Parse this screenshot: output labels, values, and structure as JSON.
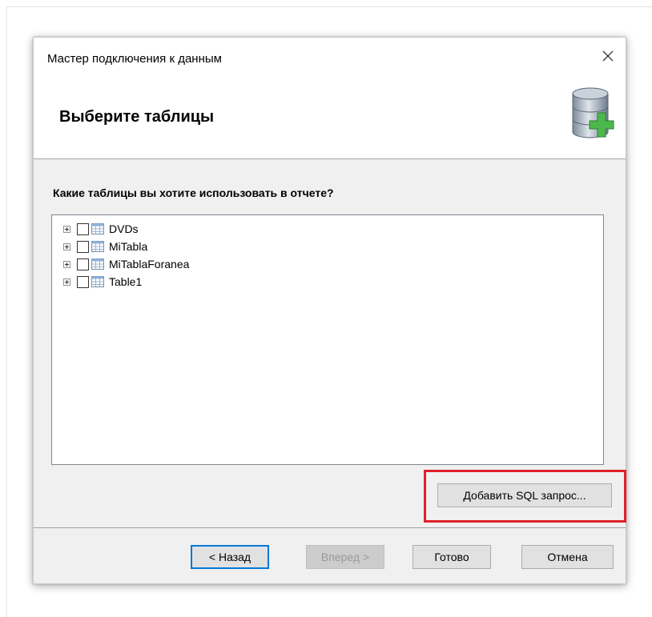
{
  "dialog": {
    "title": "Мастер подключения к данным",
    "heading": "Выберите таблицы",
    "question": "Какие таблицы вы хотите использовать в отчете?",
    "tables": [
      {
        "name": "DVDs",
        "checked": false
      },
      {
        "name": "MiTabla",
        "checked": false
      },
      {
        "name": "MiTablaForanea",
        "checked": false
      },
      {
        "name": "Table1",
        "checked": false
      }
    ],
    "add_sql_label": "Добавить SQL запрос...",
    "buttons": {
      "back": "< Назад",
      "next": "Вперед >",
      "finish": "Готово",
      "cancel": "Отмена"
    },
    "icons": {
      "close": "close-icon",
      "header": "database-add-icon",
      "table": "table-icon",
      "expander": "plus-expander-icon"
    },
    "colors": {
      "highlight": "#e0202a",
      "primary_border": "#0078d7",
      "plus_green": "#4cb84c"
    }
  }
}
